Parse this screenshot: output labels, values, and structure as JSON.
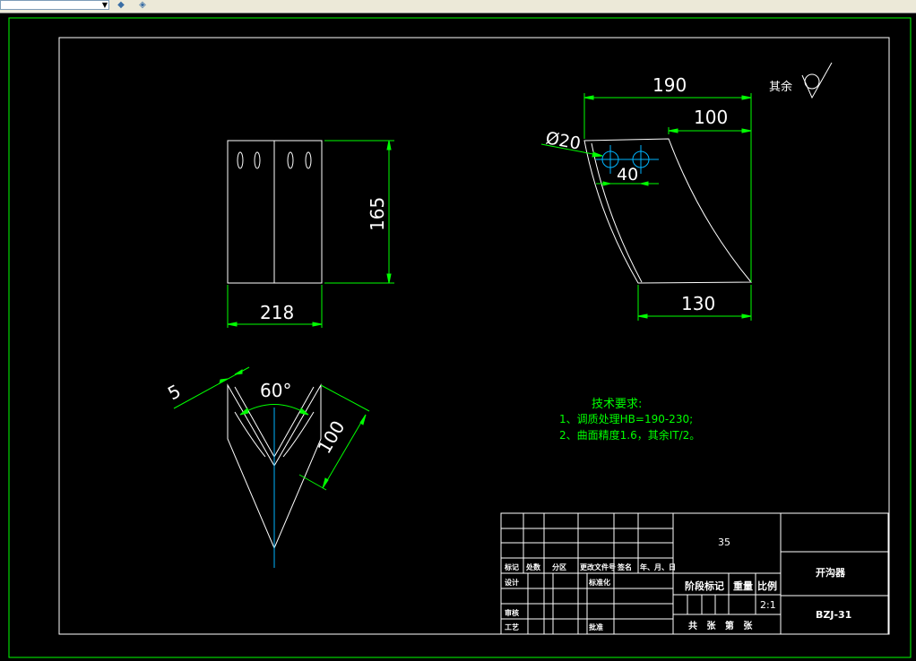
{
  "toolbar": {
    "layer_combo_value": "",
    "icons": [
      "layer-state-icon",
      "layer-previous-icon"
    ]
  },
  "colors": {
    "background": "#000000",
    "outline": "#ffffff",
    "dimension": "#00ff00",
    "centerline": "#00b4ff",
    "frame_outer": "#00ff00"
  },
  "dims": {
    "front_width": "218",
    "front_height": "165",
    "side_overall": "190",
    "side_top": "100",
    "side_bottom": "130",
    "hole_dia": "Ø20",
    "hole_spacing": "40",
    "thickness": "5",
    "angle": "60°",
    "leg_length": "100"
  },
  "roughness": {
    "label": "其余"
  },
  "tech": {
    "title": "技术要求:",
    "line1": "1、调质处理HB=190-230;",
    "line2": "2、曲面精度1.6，其余IT/2。"
  },
  "title_block": {
    "material": "35",
    "part_name": "开沟器",
    "drawing_no": "BZJ-31",
    "scale": "2:1",
    "col_stage": "阶段标记",
    "col_weight": "重量",
    "col_scale": "比例",
    "sheet_text": "共   张   第   张",
    "rev_mark": "标记",
    "rev_count": "处数",
    "rev_zone": "分区",
    "rev_doc": "更改文件号",
    "rev_sign": "签名",
    "rev_date": "年、月、日",
    "designer": "设计",
    "standardize": "标准化",
    "reviewer": "审核",
    "process": "工艺",
    "approve": "批准"
  }
}
